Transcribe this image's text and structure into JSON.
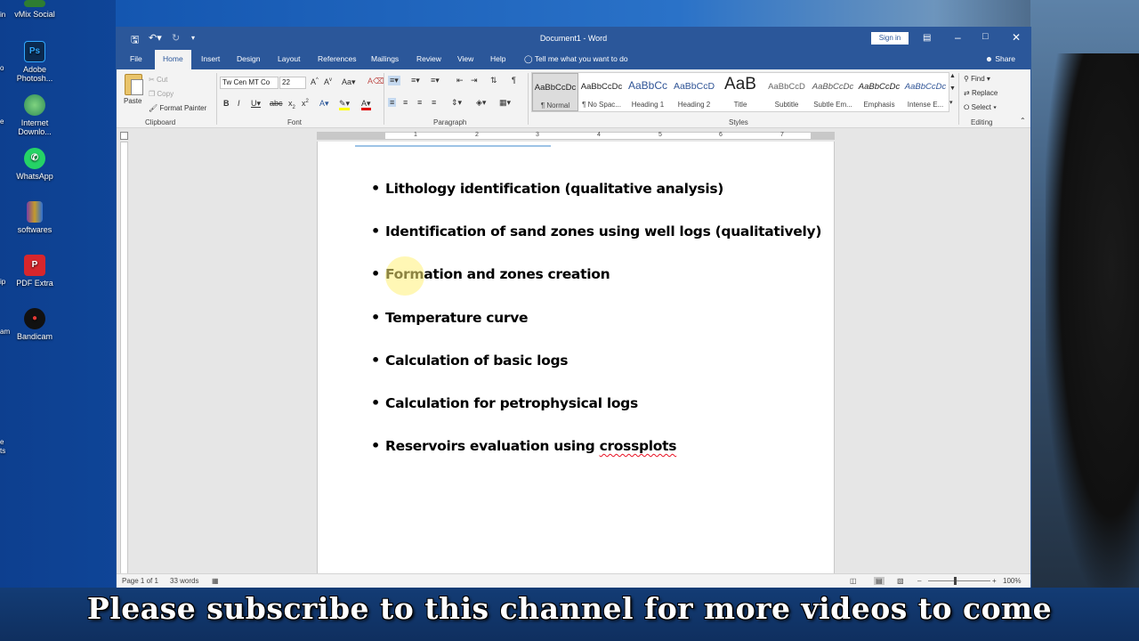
{
  "desktop": {
    "icons": [
      {
        "label": "vMix Social",
        "icon": "vmix-icon",
        "color": "#2e7d32"
      },
      {
        "label": "Adobe Photosh...",
        "icon": "photoshop-icon",
        "color": "#0b2a50",
        "glyph": "Ps"
      },
      {
        "label": "Internet Downlo...",
        "icon": "idm-icon",
        "color": "#2e8b57"
      },
      {
        "label": "WhatsApp",
        "icon": "whatsapp-icon",
        "color": "#25d366",
        "glyph": "✆"
      },
      {
        "label": "softwares",
        "icon": "archive-icon",
        "color": "#c49a2c"
      },
      {
        "label": "PDF Extra",
        "icon": "pdf-extra-icon",
        "color": "#d7262c",
        "glyph": "P"
      },
      {
        "label": "Bandicam",
        "icon": "bandicam-icon",
        "color": "#c62828",
        "glyph": "●"
      }
    ],
    "edge_fragments": [
      "in",
      "o",
      "e",
      "ip",
      "am",
      "e",
      "ts"
    ]
  },
  "word": {
    "title": "Document1 - Word",
    "sign_in": "Sign in",
    "qat": {
      "save_icon": "save-icon",
      "undo_icon": "undo-icon",
      "redo_icon": "redo-icon",
      "customize_icon": "customize-qat-icon"
    },
    "tabs": [
      "File",
      "Home",
      "Insert",
      "Design",
      "Layout",
      "References",
      "Mailings",
      "Review",
      "View",
      "Help"
    ],
    "active_tab": "Home",
    "tell_me": "Tell me what you want to do",
    "share": "Share",
    "ribbon": {
      "clipboard": {
        "label": "Clipboard",
        "paste": "Paste",
        "cut": "Cut",
        "copy": "Copy",
        "format_painter": "Format Painter"
      },
      "font": {
        "label": "Font",
        "font_name": "Tw Cen MT Co",
        "font_size": "22"
      },
      "paragraph": {
        "label": "Paragraph"
      },
      "styles": {
        "label": "Styles",
        "items": [
          {
            "preview": "AaBbCcDc",
            "name": "¶ Normal"
          },
          {
            "preview": "AaBbCcDc",
            "name": "¶ No Spac..."
          },
          {
            "preview": "AaBbCc",
            "name": "Heading 1"
          },
          {
            "preview": "AaBbCcD",
            "name": "Heading 2"
          },
          {
            "preview": "AaB",
            "name": "Title"
          },
          {
            "preview": "AaBbCcD",
            "name": "Subtitle"
          },
          {
            "preview": "AaBbCcDc",
            "name": "Subtle Em..."
          },
          {
            "preview": "AaBbCcDc",
            "name": "Emphasis"
          },
          {
            "preview": "AaBbCcDc",
            "name": "Intense E..."
          }
        ]
      },
      "editing": {
        "label": "Editing",
        "find": "Find",
        "replace": "Replace",
        "select": "Select"
      }
    },
    "ruler_numbers": [
      "1",
      "2",
      "3",
      "4",
      "5",
      "6",
      "7"
    ],
    "document": {
      "bullets": [
        "Lithology identification (qualitative analysis)",
        "Identification of sand zones using well logs (qualitatively)",
        "Formation and zones creation",
        "Temperature curve",
        "Calculation of basic logs",
        "Calculation for petrophysical logs",
        "Reservoirs evaluation using"
      ],
      "last_bullet_misspelled": "crossplots"
    },
    "status": {
      "page": "Page 1 of 1",
      "words": "33 words",
      "zoom": "100%"
    }
  },
  "subtitle": "Please subscribe to this channel for more videos to come",
  "colors": {
    "word_blue": "#2b579a",
    "subtitle_bg": "#133c75"
  }
}
